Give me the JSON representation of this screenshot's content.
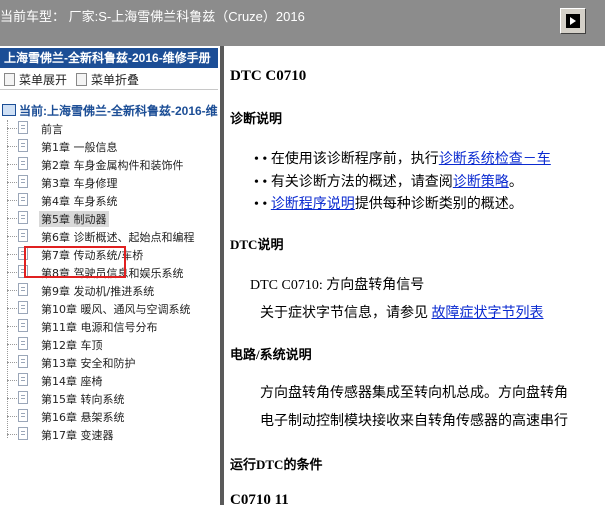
{
  "header": {
    "title": "当前车型：  厂家:S-上海雪佛兰科鲁兹（Cruze）2016"
  },
  "sidebar": {
    "book_title": "上海雪佛兰-全新科鲁兹-2016-维修手册",
    "expand_label": "菜单展开",
    "collapse_label": "菜单折叠",
    "root_label": "当前:上海雪佛兰-全新科鲁兹-2016-维",
    "items": [
      {
        "label": "前言"
      },
      {
        "label": "第1章 一般信息"
      },
      {
        "label": "第2章 车身金属构件和装饰件"
      },
      {
        "label": "第3章 车身修理"
      },
      {
        "label": "第4章 车身系统"
      },
      {
        "label": "第5章 制动器"
      },
      {
        "label": "第6章 诊断概述、起始点和编程"
      },
      {
        "label": "第7章 传动系统/车桥"
      },
      {
        "label": "第8章 驾驶员信息和娱乐系统"
      },
      {
        "label": "第9章 发动机/推进系统"
      },
      {
        "label": "第10章 暖风、通风与空调系统"
      },
      {
        "label": "第11章 电源和信号分布"
      },
      {
        "label": "第12章 车顶"
      },
      {
        "label": "第13章 安全和防护"
      },
      {
        "label": "第14章 座椅"
      },
      {
        "label": "第15章 转向系统"
      },
      {
        "label": "第16章 悬架系统"
      },
      {
        "label": "第17章 变速器"
      }
    ],
    "selected_index": 5
  },
  "content": {
    "title": "DTC C0710",
    "diag_heading": "诊断说明",
    "bullet1_prefix": "有关诊断方法的概述，请查阅",
    "bullet1_prefix_full": "在使用该诊断程序前，执行",
    "bullet1_link": "诊断系统检查－车",
    "bullet2_prefix": "有关诊断方法的概述，请查阅",
    "bullet2_link": "诊断策略",
    "bullet2_suffix": "。",
    "bullet3_link": "诊断程序说明",
    "bullet3_suffix": "提供每种诊断类别的概述。",
    "dtc_heading": "DTC说明",
    "dtc_desc": "DTC C0710: 方向盘转角信号",
    "symptom_prefix": "关于症状字节信息，请参见 ",
    "symptom_link": "故障症状字节列表",
    "circuit_heading": "电路/系统说明",
    "circuit_line1": "方向盘转角传感器集成至转向机总成。方向盘转角",
    "circuit_line2": "电子制动控制模块接收来自转角传感器的高速串行",
    "run_heading": "运行DTC的条件",
    "next_title": "C0710 11"
  },
  "colors": {
    "topbar": "#8c8c8c",
    "book_header": "#1c4e96",
    "link": "#0a2ad0",
    "highlight": "#e02020"
  }
}
